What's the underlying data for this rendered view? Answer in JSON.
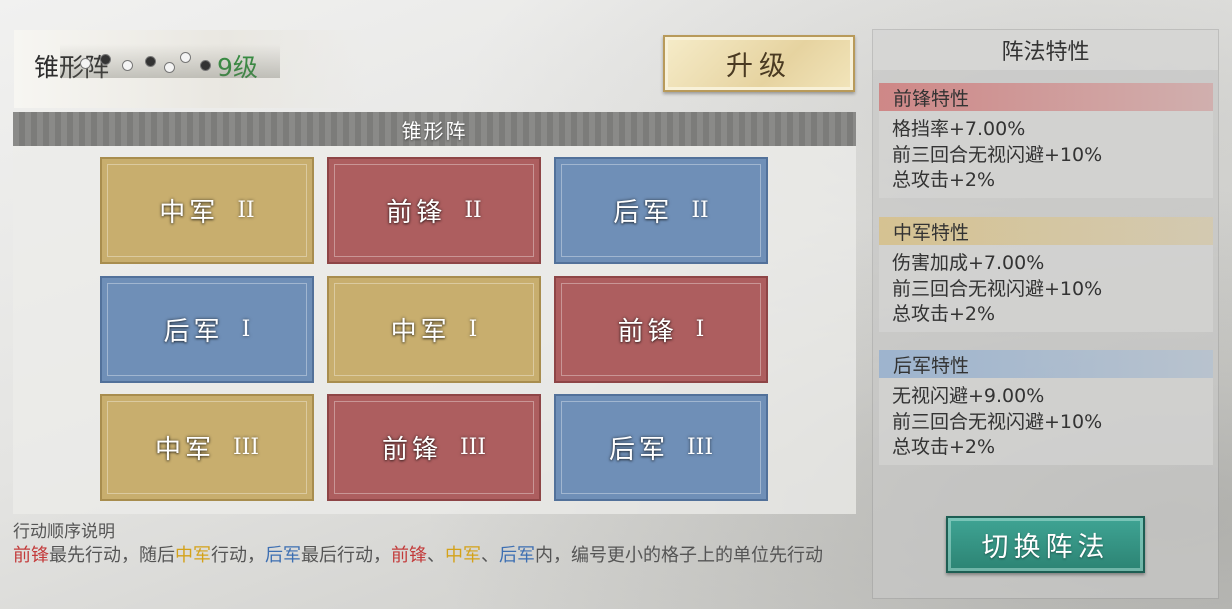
{
  "header": {
    "formation_name": "锥形阵",
    "level": "9级"
  },
  "upgrade_label": "升级",
  "grid": {
    "title": "锥形阵",
    "cells": [
      {
        "label": "中军",
        "num": "II"
      },
      {
        "label": "前锋",
        "num": "II"
      },
      {
        "label": "后军",
        "num": "II"
      },
      {
        "label": "后军",
        "num": "I"
      },
      {
        "label": "中军",
        "num": "I"
      },
      {
        "label": "前锋",
        "num": "I"
      },
      {
        "label": "中军",
        "num": "III"
      },
      {
        "label": "前锋",
        "num": "III"
      },
      {
        "label": "后军",
        "num": "III"
      }
    ]
  },
  "order": {
    "title": "行动顺序说明",
    "parts": [
      "前锋",
      "最先行动，随后",
      "中军",
      "行动，",
      "后军",
      "最后行动，",
      "前锋",
      "、",
      "中军",
      "、",
      "后军",
      "内，编号更小的格子上的单位先行动"
    ]
  },
  "traits": {
    "title": "阵法特性",
    "front": {
      "head": "前锋特性",
      "lines": [
        "格挡率+7.00%",
        "前三回合无视闪避+10%",
        "总攻击+2%"
      ]
    },
    "mid": {
      "head": "中军特性",
      "lines": [
        "伤害加成+7.00%",
        "前三回合无视闪避+10%",
        "总攻击+2%"
      ]
    },
    "rear": {
      "head": "后军特性",
      "lines": [
        "无视闪避+9.00%",
        "前三回合无视闪避+10%",
        "总攻击+2%"
      ]
    }
  },
  "switch_label": "切换阵法",
  "colors": {
    "front": "#ad5e5f",
    "mid": "#c8ae6e",
    "rear": "#6f8fb7",
    "level": "#2f8f3c",
    "switch": "#2c8373"
  }
}
